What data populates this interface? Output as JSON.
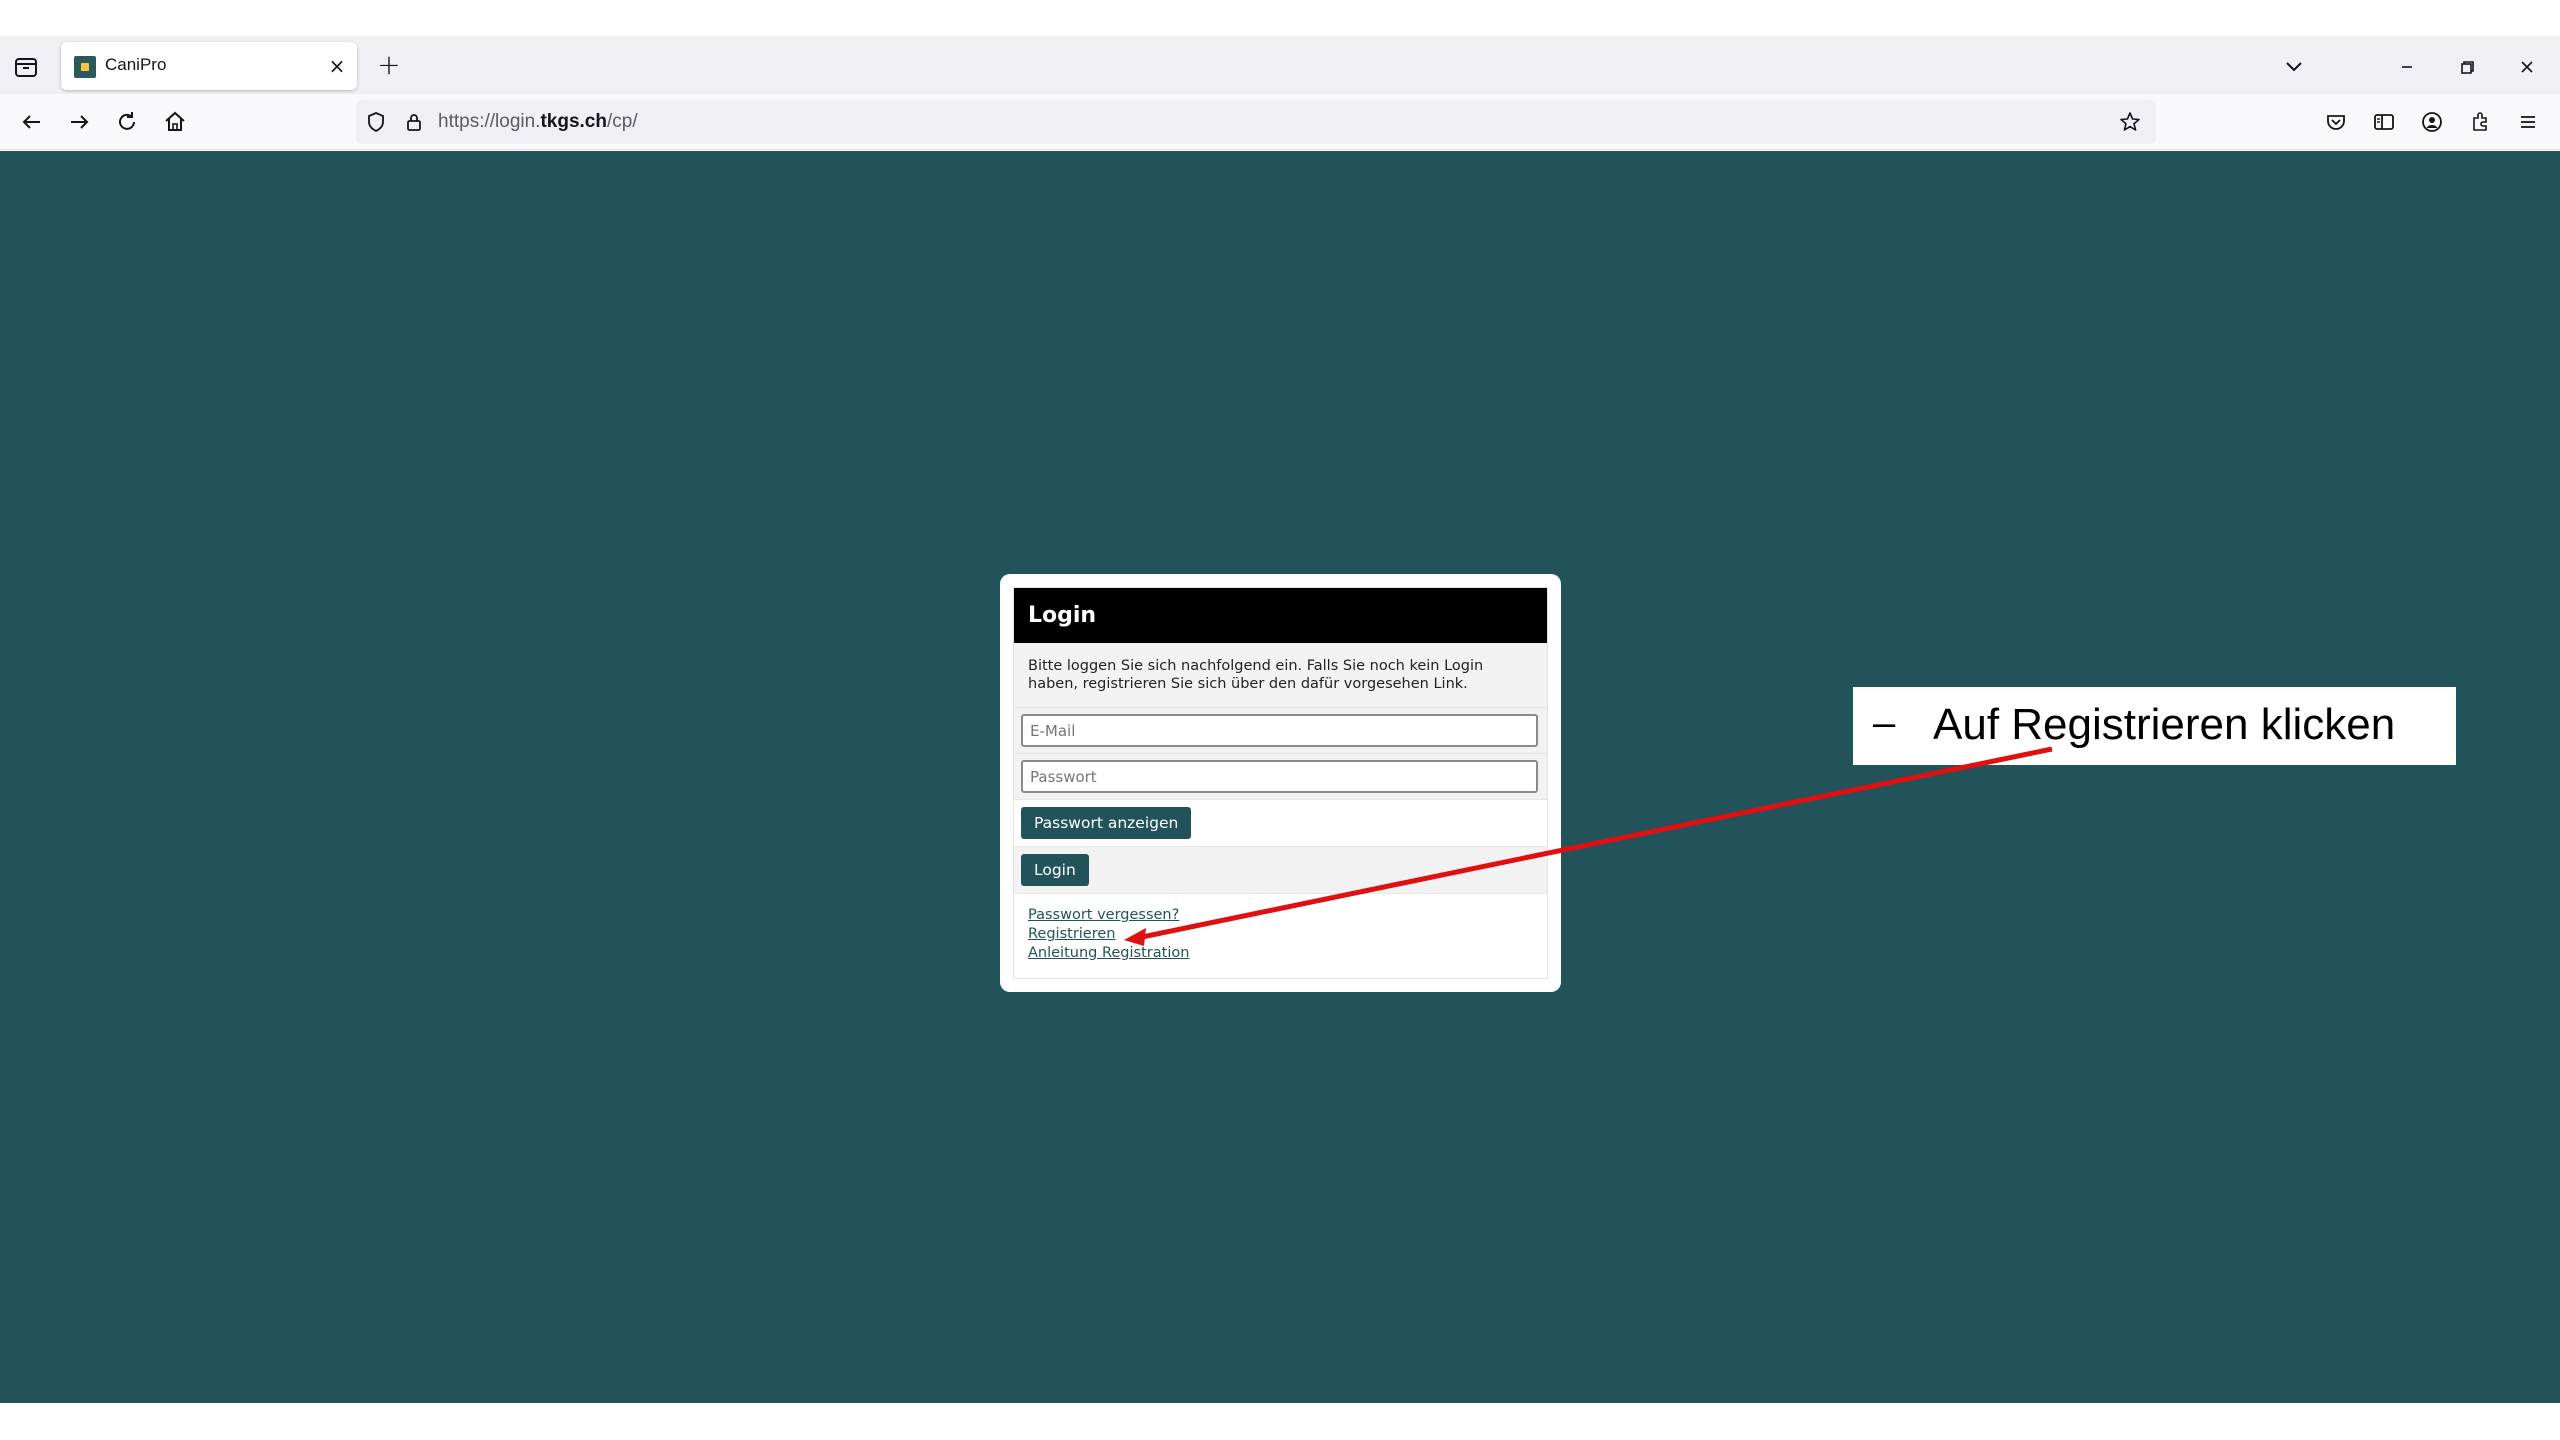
{
  "browser": {
    "tab": {
      "title": "CaniPro",
      "close_icon": "close-icon",
      "favicon": "canipro-favicon"
    },
    "new_tab_symbol": "+",
    "tab_close_symbol": "×",
    "url": {
      "prefix": "https://login.",
      "domain": "tkgs.ch",
      "path": "/cp/"
    },
    "icons": [
      "tab-overview-icon",
      "back-arrow-icon",
      "forward-arrow-icon",
      "reload-icon",
      "home-icon",
      "shield-icon",
      "lock-icon",
      "star-icon",
      "pocket-icon",
      "sidebar-icon",
      "account-icon",
      "extensions-icon",
      "menu-icon",
      "tab-list-chevron-icon",
      "minimize-icon",
      "restore-icon",
      "window-close-icon"
    ]
  },
  "colors": {
    "page_background": "#23535a",
    "button": "#23535a",
    "header": "#000000",
    "annotation_arrow": "#e01010"
  },
  "login": {
    "title": "Login",
    "intro": "Bitte loggen Sie sich nachfolgend ein. Falls Sie noch kein Login haben, registrieren Sie sich über den dafür vorgesehen Link.",
    "email_placeholder": "E-Mail",
    "password_placeholder": "Passwort",
    "show_password_button": "Passwort anzeigen",
    "login_button": "Login",
    "links": {
      "forgot_password": "Passwort vergessen?",
      "register": "Registrieren",
      "registration_guide": "Anleitung Registration"
    }
  },
  "annotation": {
    "dash": "–",
    "text": "Auf Registrieren klicken"
  }
}
